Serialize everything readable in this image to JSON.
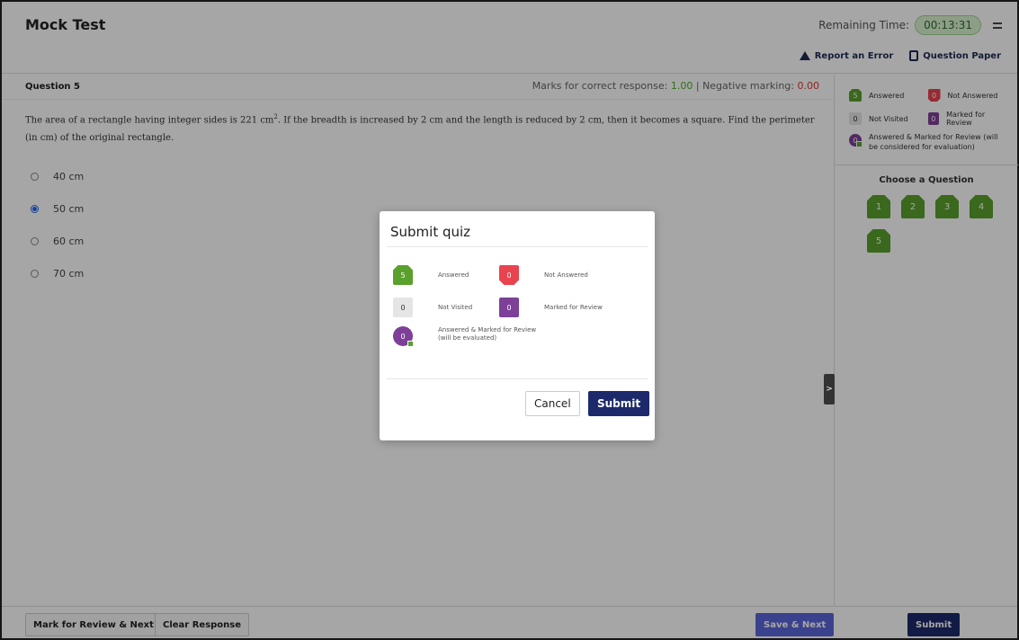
{
  "header": {
    "title": "Mock Test",
    "remaining_label": "Remaining Time:",
    "timer": "00:13:31",
    "report_error": "Report an Error",
    "question_paper": "Question Paper"
  },
  "question": {
    "label": "Question 5",
    "marks_label": "Marks for correct response:",
    "marks_value": "1.00",
    "separator": "|",
    "negative_label": "Negative marking:",
    "negative_value": "0.00",
    "text_part1": "The area of a rectangle having integer sides is 221 cm",
    "text_sup": "2",
    "text_part2": ". If the breadth is increased by 2 cm and the length is reduced by 2 cm, then it becomes a square. Find the perimeter (in cm) of the original rectangle.",
    "options": [
      {
        "label": "40 cm",
        "selected": false
      },
      {
        "label": "50 cm",
        "selected": true
      },
      {
        "label": "60 cm",
        "selected": false
      },
      {
        "label": "70 cm",
        "selected": false
      }
    ]
  },
  "legend": {
    "answered_count": "5",
    "answered_label": "Answered",
    "not_answered_count": "0",
    "not_answered_label": "Not Answered",
    "not_visited_count": "0",
    "not_visited_label": "Not Visited",
    "marked_count": "0",
    "marked_label": "Marked for Review",
    "answered_marked_count": "0",
    "answered_marked_label": "Answered & Marked for Review (will be considered for evaluation)"
  },
  "chooser": {
    "title": "Choose a Question",
    "questions": [
      "1",
      "2",
      "3",
      "4",
      "5"
    ]
  },
  "bottom": {
    "mark_review": "Mark for Review & Next",
    "clear": "Clear Response",
    "save_next": "Save & Next",
    "submit": "Submit"
  },
  "toggle": ">",
  "modal": {
    "title": "Submit quiz",
    "answered_count": "5",
    "answered_label": "Answered",
    "not_answered_count": "0",
    "not_answered_label": "Not Answered",
    "not_visited_count": "0",
    "not_visited_label": "Not Visited",
    "marked_count": "0",
    "marked_label": "Marked for Review",
    "answered_marked_count": "0",
    "answered_marked_line1": "Answered & Marked for Review",
    "answered_marked_line2": "(will be evaluated)",
    "cancel": "Cancel",
    "submit": "Submit"
  },
  "colors": {
    "answered": "#5aa02c",
    "not_answered": "#e8434f",
    "marked": "#7d3f98",
    "primary": "#1c2a6b",
    "save": "#5b66d9"
  }
}
